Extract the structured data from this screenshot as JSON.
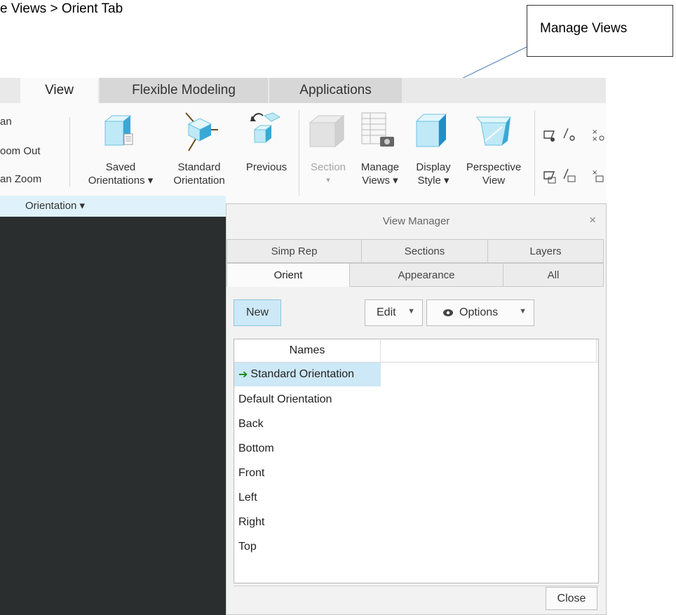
{
  "caption": "e Views > Orient Tab",
  "callout": {
    "label": "Manage Views"
  },
  "ribbon_tabs": [
    {
      "label": "View"
    },
    {
      "label": "Flexible Modeling"
    },
    {
      "label": "Applications"
    }
  ],
  "ribbon": {
    "left_items": [
      "an",
      "oom Out",
      "an Zoom"
    ],
    "saved": {
      "line1": "Saved",
      "line2": "Orientations ▾"
    },
    "standard": {
      "line1": "Standard",
      "line2": "Orientation"
    },
    "previous": {
      "label": "Previous"
    },
    "section": {
      "line1": "Section",
      "line2": "▾"
    },
    "manage": {
      "line1": "Manage",
      "line2": "Views ▾"
    },
    "display": {
      "line1": "Display",
      "line2": "Style ▾"
    },
    "perspective": {
      "line1": "Perspective",
      "line2": "View"
    },
    "group_label": "Orientation ▾"
  },
  "dialog": {
    "title": "View Manager",
    "close_glyph": "×",
    "tabs_row1": [
      {
        "label": "Simp Rep"
      },
      {
        "label": "Sections"
      },
      {
        "label": "Layers"
      }
    ],
    "tabs_row2": [
      {
        "label": "Orient"
      },
      {
        "label": "Appearance"
      },
      {
        "label": "All"
      }
    ],
    "new_label": "New",
    "edit_label": "Edit",
    "options_label": "Options",
    "column_header": "Names",
    "rows": [
      "Standard Orientation",
      "Default Orientation",
      "Back",
      "Bottom",
      "Front",
      "Left",
      "Right",
      "Top"
    ],
    "close_label": "Close"
  }
}
